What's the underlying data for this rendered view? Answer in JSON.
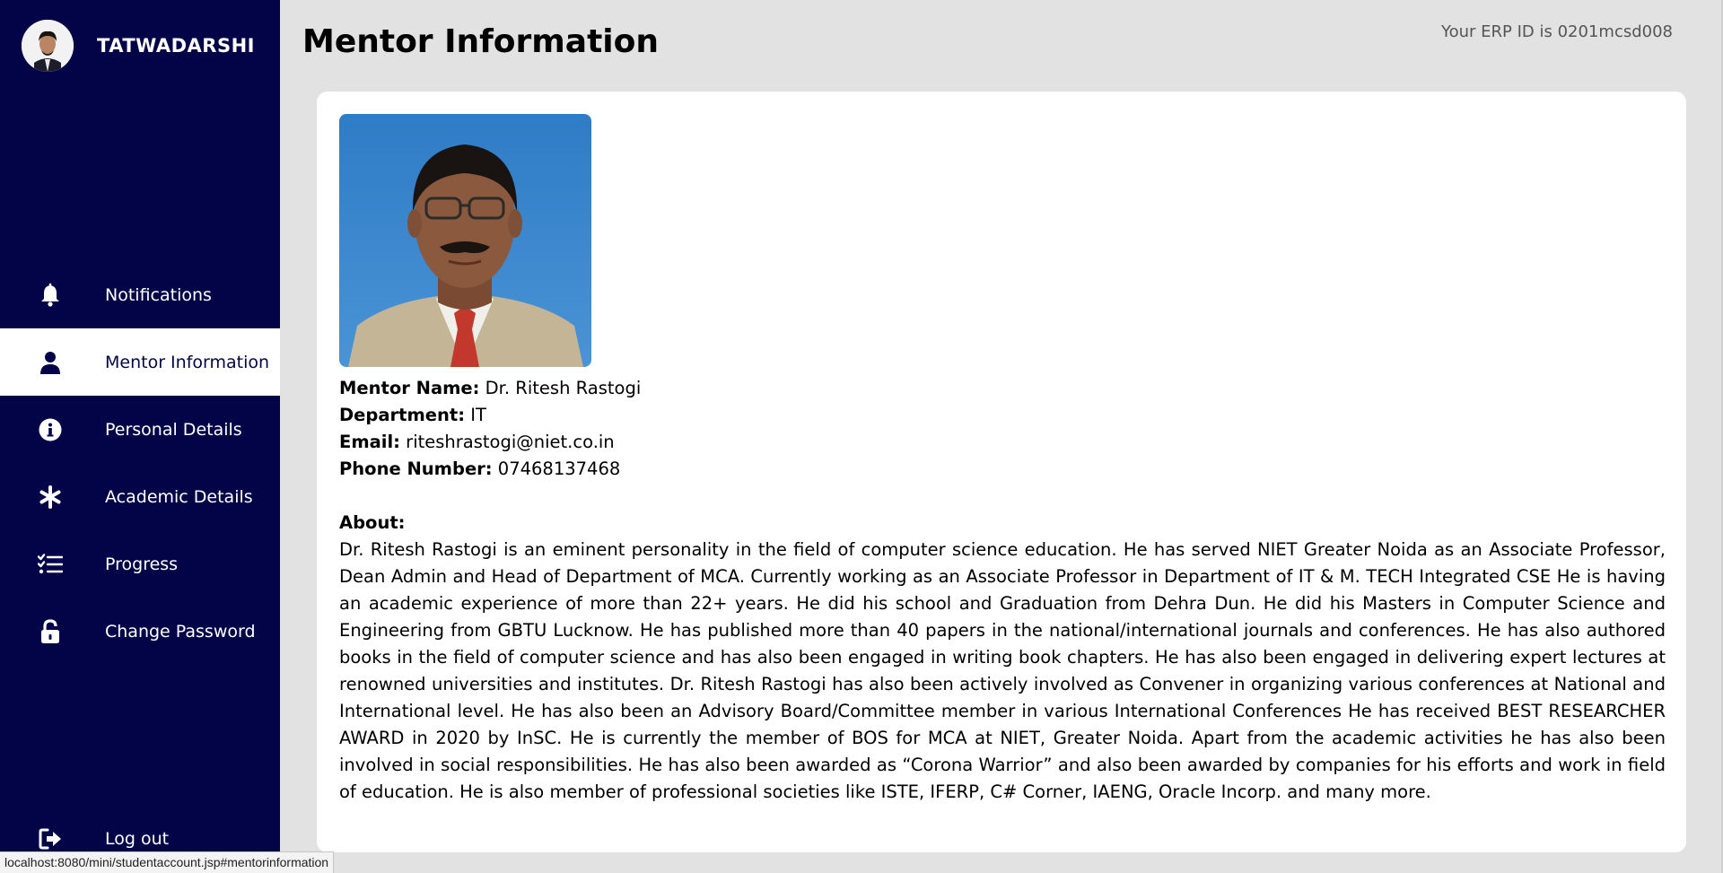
{
  "brand": {
    "name": "TATWADARSHI",
    "avatar_icon": "student-avatar"
  },
  "sidebar": {
    "items": [
      {
        "label": "Notifications",
        "icon": "bell-icon",
        "active": false
      },
      {
        "label": "Mentor Information",
        "icon": "user-icon",
        "active": true
      },
      {
        "label": "Personal Details",
        "icon": "info-circle-icon",
        "active": false
      },
      {
        "label": "Academic Details",
        "icon": "asterisk-icon",
        "active": false
      },
      {
        "label": "Progress",
        "icon": "checklist-icon",
        "active": false
      },
      {
        "label": "Change Password",
        "icon": "unlock-icon",
        "active": false
      }
    ],
    "logout_label": "Log out"
  },
  "header": {
    "title": "Mentor Information",
    "erp_text": "Your ERP ID is 0201mcsd008"
  },
  "mentor": {
    "name_label": "Mentor Name:",
    "name": "Dr. Ritesh Rastogi",
    "department_label": "Department:",
    "department": "IT",
    "email_label": "Email:",
    "email": "riteshrastogi@niet.co.in",
    "phone_label": "Phone Number:",
    "phone": "07468137468",
    "about_label": "About:",
    "about": "Dr. Ritesh Rastogi is an eminent personality in the field of computer science education. He has served NIET Greater Noida as an Associate Professor, Dean Admin and Head of Department of MCA. Currently working as an Associate Professor in Department of IT & M. TECH Integrated CSE He is having an academic experience of more than 22+ years. He did his school and Graduation from Dehra Dun. He did his Masters in Computer Science and Engineering from GBTU Lucknow. He has published more than 40 papers in the national/international journals and conferences. He has also authored books in the field of computer science and has also been engaged in writing book chapters. He has also been engaged in delivering expert lectures at renowned universities and institutes. Dr. Ritesh Rastogi has also been actively involved as Convener in organizing various conferences at National and International level. He has also been an Advisory Board/Committee member in various International Conferences He has received BEST RESEARCHER AWARD in 2020 by InSC. He is currently the member of BOS for MCA at NIET, Greater Noida. Apart from the academic activities he has also been involved in social responsibilities. He has also been awarded as “Corona Warrior” and also been awarded by companies for his efforts and work in field of education. He is also member of professional societies like ISTE, IFERP, C# Corner, IAENG, Oracle Incorp. and many more."
  },
  "statusbar": {
    "url": "localhost:8080/mini/studentaccount.jsp#mentorinformation"
  },
  "colors": {
    "sidebar_bg": "#020447",
    "page_bg": "#e2e2e2",
    "card_bg": "#ffffff"
  }
}
